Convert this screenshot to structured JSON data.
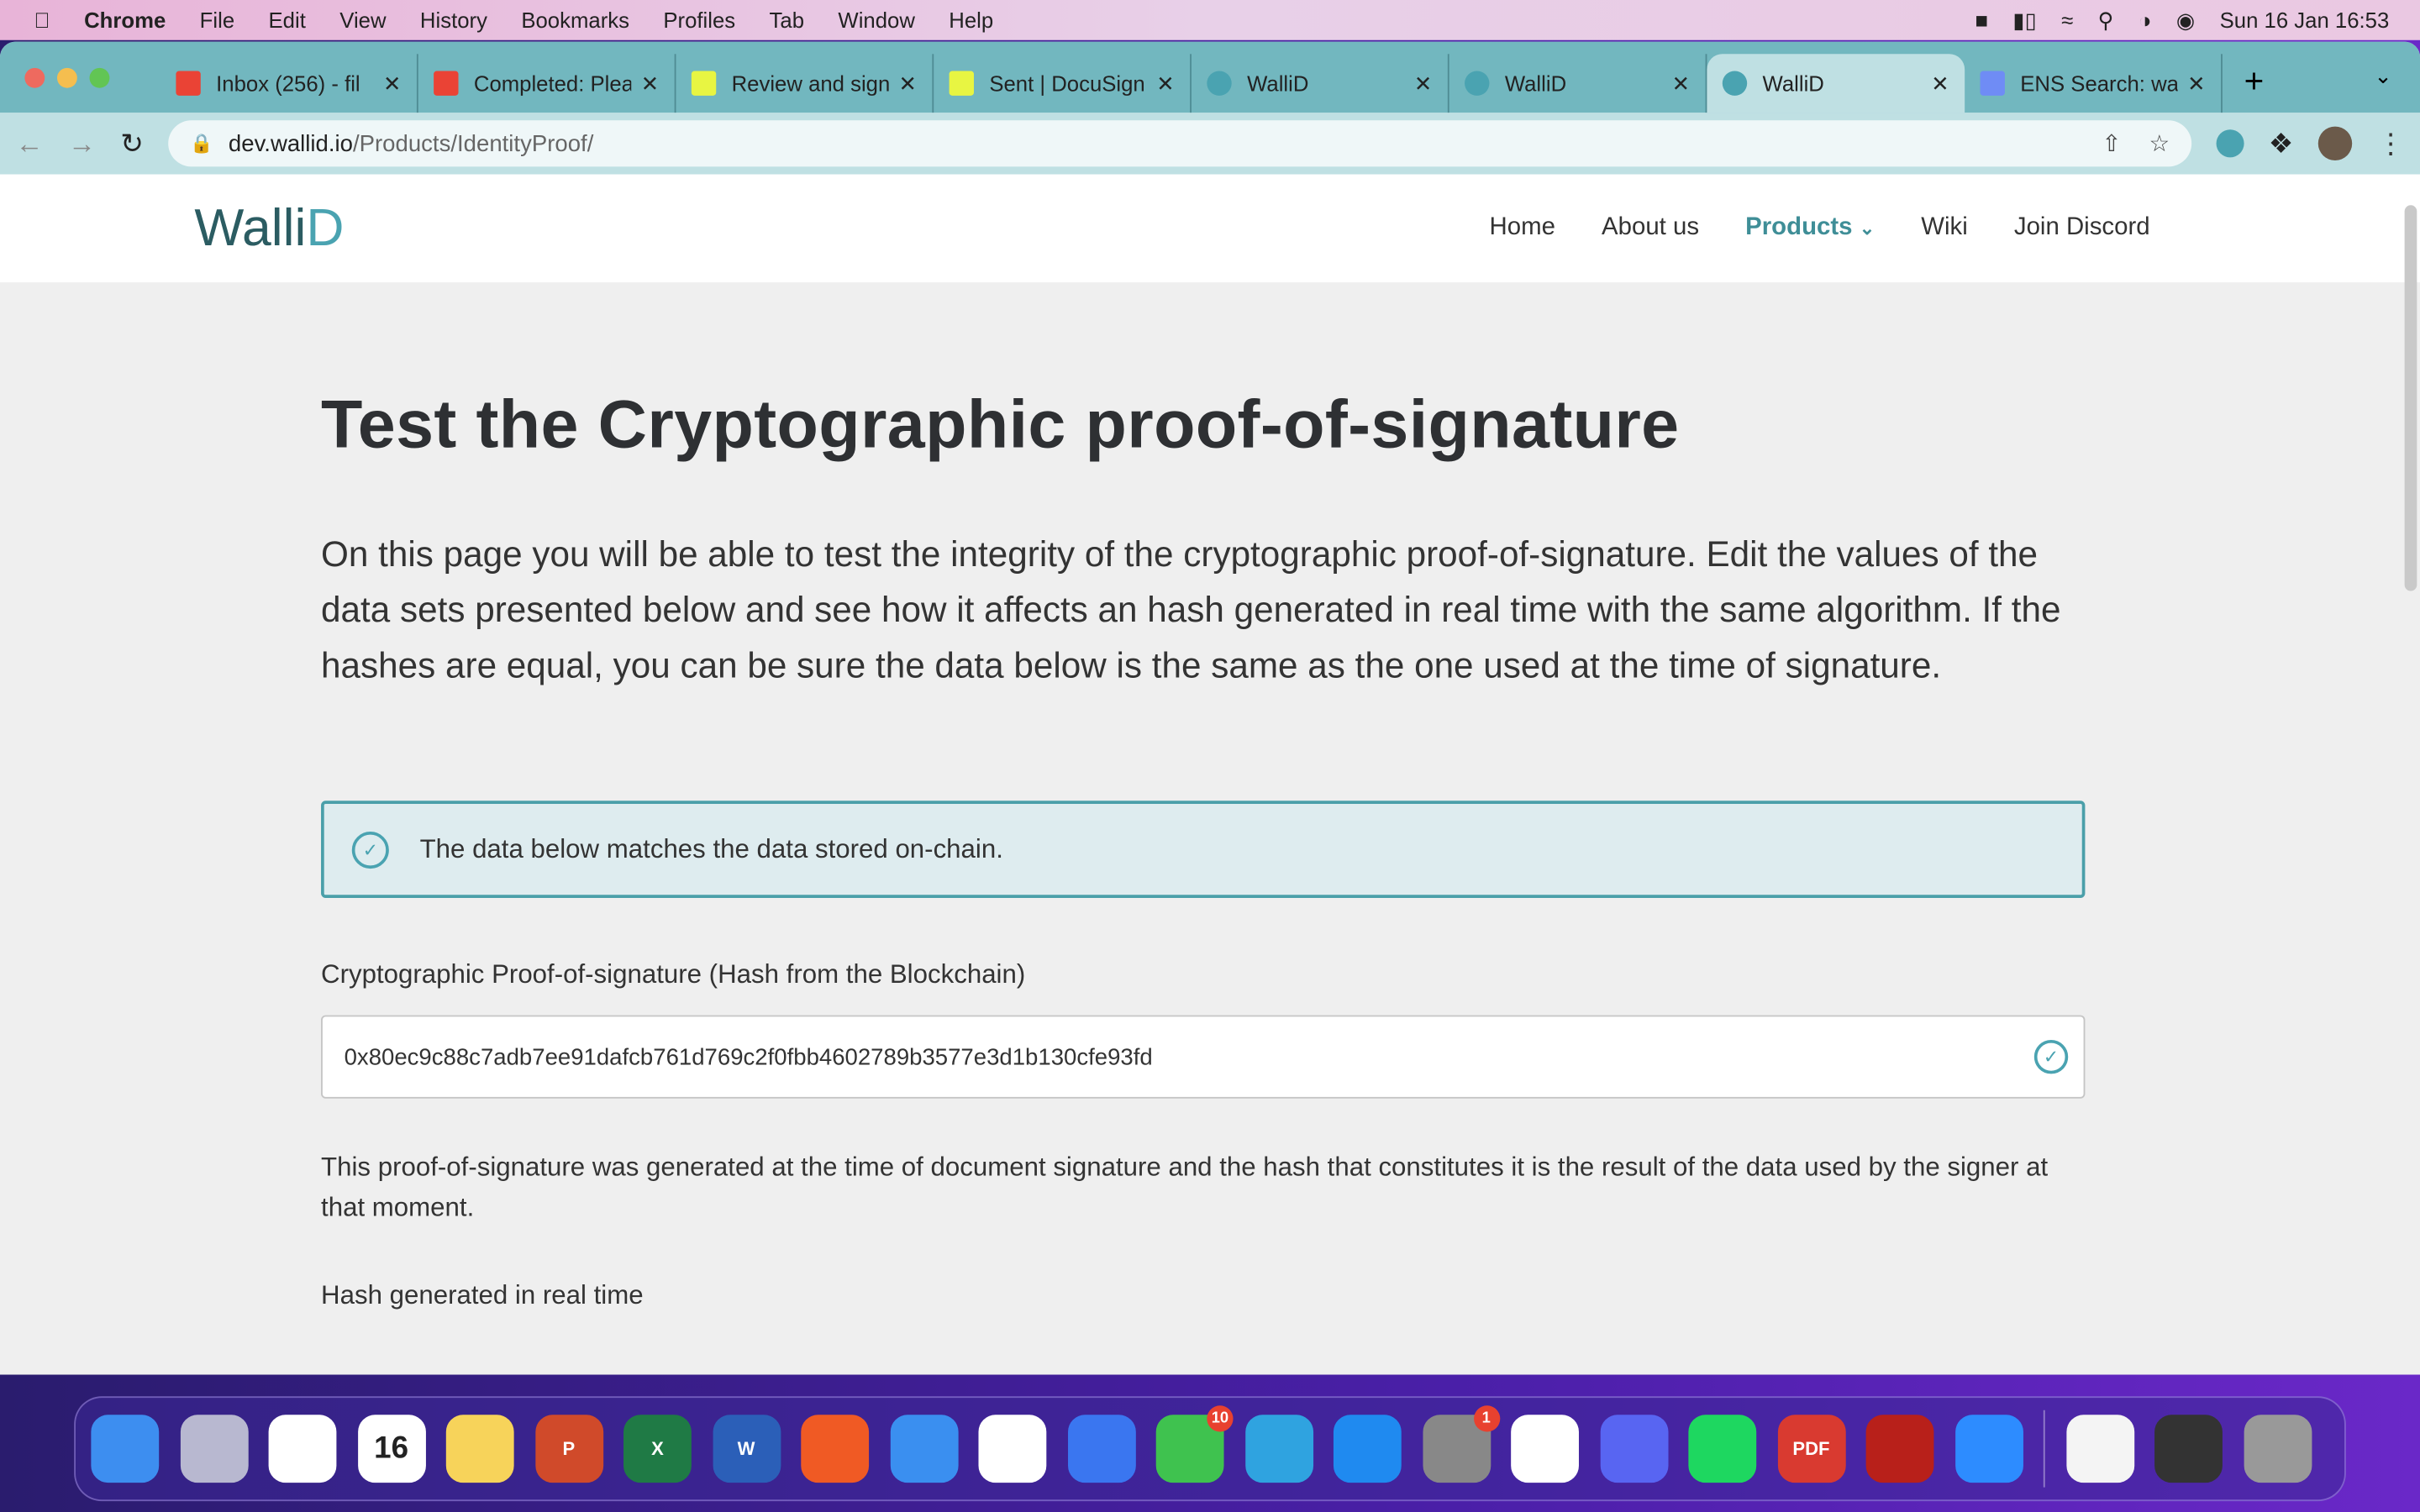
{
  "menubar": {
    "app": "Chrome",
    "items": [
      "File",
      "Edit",
      "View",
      "History",
      "Bookmarks",
      "Profiles",
      "Tab",
      "Window",
      "Help"
    ],
    "clock": "Sun 16 Jan  16:53"
  },
  "tabs": [
    {
      "title": "Inbox (256) - fil",
      "icon": "gmail-icon",
      "color": "#ea4335"
    },
    {
      "title": "Completed: Plea",
      "icon": "gmail-icon",
      "color": "#ea4335"
    },
    {
      "title": "Review and sign",
      "icon": "docusign-icon",
      "color": "#e8f542"
    },
    {
      "title": "Sent | DocuSign",
      "icon": "docusign-icon",
      "color": "#e8f542"
    },
    {
      "title": "WalliD",
      "icon": "wallid-icon",
      "color": "#4aa3b1"
    },
    {
      "title": "WalliD",
      "icon": "wallid-icon",
      "color": "#4aa3b1"
    },
    {
      "title": "WalliD",
      "icon": "wallid-icon",
      "color": "#4aa3b1",
      "active": true
    },
    {
      "title": "ENS Search: wa",
      "icon": "ens-icon",
      "color": "#6f8cf5"
    }
  ],
  "address": {
    "domain": "dev.wallid.io",
    "path": "/Products/IdentityProof/"
  },
  "site": {
    "logo": "WalliD",
    "nav": [
      "Home",
      "About us",
      "Products",
      "Wiki",
      "Join Discord"
    ],
    "active_nav": "Products"
  },
  "main": {
    "title": "Test the Cryptographic proof-of-signature",
    "lead": "On this page you will be able to test the integrity of the cryptographic proof-of-signature. Edit the values of the data sets presented below and see how it affects an hash generated in real time with the same algorithm. If the hashes are equal, you can be sure the data below is the same as the one used at the time of signature.",
    "alert": "The data below matches the data stored on-chain.",
    "hash_label": "Cryptographic Proof-of-signature (Hash from the Blockchain)",
    "hash_value": "0x80ec9c88c7adb7ee91dafcb761d769c2f0fbb4602789b3577e3d1b130cfe93fd",
    "note": "This proof-of-signature was generated at the time of document signature and the hash that constitutes it is the result of the data used by the signer at that moment.",
    "realtime_label": "Hash generated in real time"
  },
  "colors": {
    "accent": "#4aa3b1",
    "tabbar": "#72b7bf"
  },
  "dock": [
    {
      "name": "finder",
      "color": "#3d8ef0"
    },
    {
      "name": "launchpad",
      "color": "#b8b8d0"
    },
    {
      "name": "photos",
      "color": "#ffffff"
    },
    {
      "name": "calendar",
      "color": "#ffffff",
      "label": "16"
    },
    {
      "name": "notes",
      "color": "#f7d35a"
    },
    {
      "name": "powerpoint",
      "color": "#d04a2a",
      "label": "P"
    },
    {
      "name": "excel",
      "color": "#1f7a45",
      "label": "X"
    },
    {
      "name": "word",
      "color": "#2b5fb8",
      "label": "W"
    },
    {
      "name": "brave",
      "color": "#f05a24"
    },
    {
      "name": "keynote",
      "color": "#3a8ff0"
    },
    {
      "name": "slack",
      "color": "#ffffff"
    },
    {
      "name": "signal",
      "color": "#3a76f0"
    },
    {
      "name": "whatsapp",
      "color": "#3fc24f",
      "badge": "10"
    },
    {
      "name": "telegram",
      "color": "#2fa3e0"
    },
    {
      "name": "app-store",
      "color": "#1f8af0"
    },
    {
      "name": "system-preferences",
      "color": "#888888",
      "badge": "1"
    },
    {
      "name": "chrome",
      "color": "#ffffff"
    },
    {
      "name": "discord",
      "color": "#5865f2"
    },
    {
      "name": "spotify",
      "color": "#1ed760"
    },
    {
      "name": "pdf-expert",
      "color": "#d93a30",
      "label": "PDF"
    },
    {
      "name": "acrobat",
      "color": "#b8201a"
    },
    {
      "name": "zoom",
      "color": "#2d8cff"
    }
  ]
}
